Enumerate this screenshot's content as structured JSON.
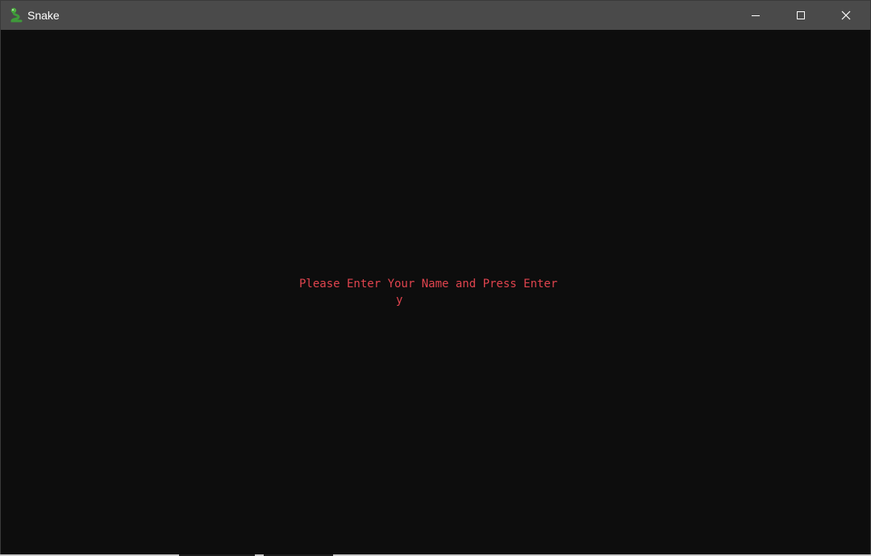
{
  "window": {
    "title": "Snake",
    "app_icon": "snake-icon",
    "controls": {
      "minimize_icon": "minimize-icon",
      "maximize_icon": "maximize-icon",
      "close_icon": "close-icon"
    }
  },
  "game": {
    "prompt": "Please Enter Your Name and Press Enter",
    "name_input_value": "y",
    "text_color": "#e0444e",
    "background_color": "#0d0d0d"
  },
  "colors": {
    "titlebar": "#4a4a4a",
    "icon_green": "#3f9a3a"
  }
}
